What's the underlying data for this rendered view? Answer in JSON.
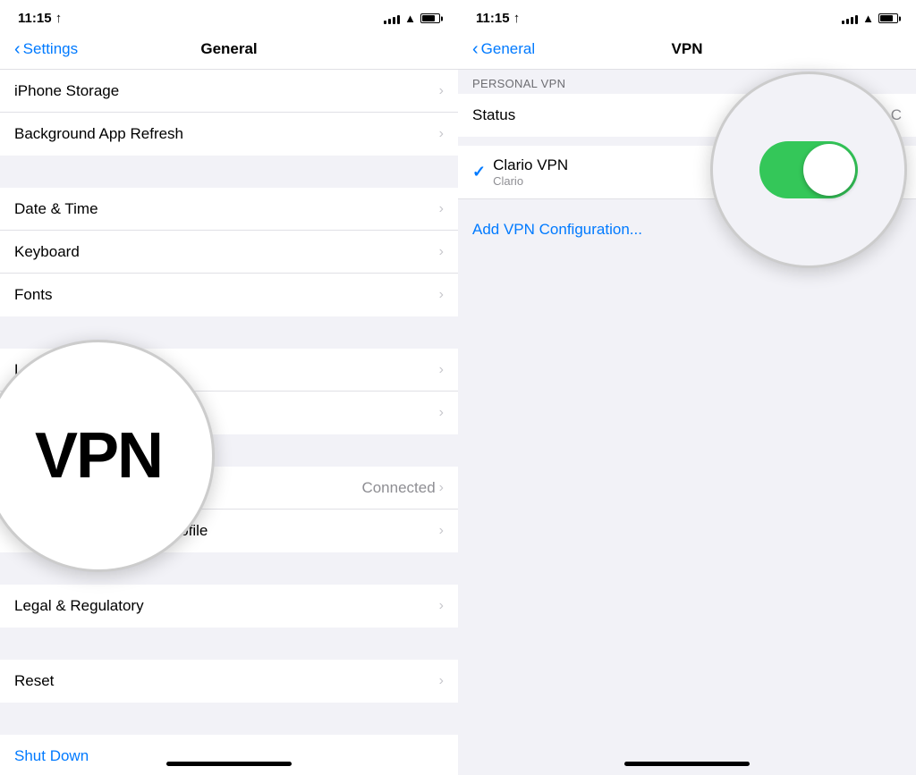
{
  "left_screen": {
    "status_bar": {
      "time": "11:15 ↑",
      "signal_bars": [
        4,
        6,
        8,
        10,
        12
      ],
      "wifi": "wifi",
      "battery": "battery"
    },
    "nav": {
      "back_label": "Settings",
      "title": "General"
    },
    "rows": [
      {
        "label": "iPhone Storage",
        "value": "",
        "has_chevron": true
      },
      {
        "label": "Background App Refresh",
        "value": "",
        "has_chevron": true
      },
      {
        "separator": true
      },
      {
        "label": "Date & Time",
        "value": "",
        "has_chevron": true
      },
      {
        "label": "Keyboard",
        "value": "",
        "has_chevron": true
      },
      {
        "label": "Fonts",
        "value": "",
        "has_chevron": true
      },
      {
        "separator": true
      },
      {
        "label": "Language & Region",
        "value": "",
        "has_chevron": true
      },
      {
        "label": "",
        "value": "",
        "has_chevron": true
      },
      {
        "separator": true
      },
      {
        "label": "VPN",
        "value": "Connected",
        "has_chevron": true
      },
      {
        "label": "iOS 14 Beta Software Profile",
        "value": "",
        "has_chevron": true
      },
      {
        "separator": true
      },
      {
        "label": "Legal & Regulatory",
        "value": "",
        "has_chevron": true
      },
      {
        "separator": true
      },
      {
        "label": "Reset",
        "value": "",
        "has_chevron": true
      },
      {
        "separator": true
      },
      {
        "label": "Shut Down",
        "value": "",
        "has_chevron": false,
        "is_blue": true
      }
    ],
    "vpn_circle_text": "VPN"
  },
  "right_screen": {
    "status_bar": {
      "time": "11:15 ↑"
    },
    "nav": {
      "back_label": "General",
      "title": "VPN"
    },
    "section_header": "PERSONAL VPN",
    "status_row": {
      "label": "Status",
      "value": "C"
    },
    "vpn_item": {
      "name": "Clario VPN",
      "subtitle": "Clario",
      "checked": true
    },
    "add_vpn": "Add VPN Configuration...",
    "toggle_on": true
  }
}
